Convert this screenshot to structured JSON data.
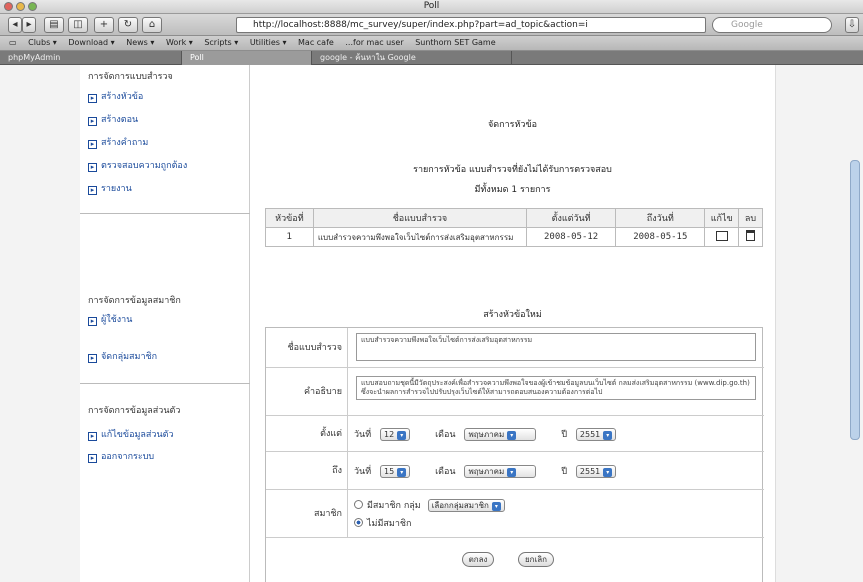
{
  "window": {
    "title": "Poll"
  },
  "toolbar": {
    "url": "http://localhost:8888/mc_survey/super/index.php?part=ad_topic&action=i",
    "search_placeholder": "Google"
  },
  "bookmarks": [
    "Clubs ▾",
    "Download ▾",
    "News ▾",
    "Work ▾",
    "Scripts ▾",
    "Utilities ▾",
    "Mac cafe",
    "...for mac user",
    "Sunthorn SET Game"
  ],
  "tabs": [
    "phpMyAdmin",
    "Poll",
    "google - ค้นหาใน Google"
  ],
  "sidebar": {
    "section1": {
      "title": "การจัดการแบบสำรวจ",
      "items": [
        "สร้างหัวข้อ",
        "สร้างตอน",
        "สร้างคำถาม",
        "ตรวจสอบความถูกต้อง",
        "รายงาน"
      ]
    },
    "section2": {
      "title": "การจัดการข้อมูลสมาชิก",
      "items": [
        "ผู้ใช้งาน",
        "จัดกลุ่มสมาชิก"
      ]
    },
    "section3": {
      "title": "การจัดการข้อมูลส่วนตัว",
      "items": [
        "แก้ไขข้อมูลส่วนตัว",
        "ออกจากระบบ"
      ]
    }
  },
  "main": {
    "page_title": "จัดการหัวข้อ",
    "list_title": "รายการหัวข้อ แบบสำรวจที่ยังไม่ได้รับการตรวจสอบ",
    "count_text": "มีทั้งหมด 1 รายการ",
    "table": {
      "headers": [
        "หัวข้อที่",
        "ชื่อแบบสำรวจ",
        "ตั้งแต่วันที่",
        "ถึงวันที่",
        "แก้ไข",
        "ลบ"
      ],
      "rows": [
        [
          "1",
          "แบบสำรวจความพึงพอใจเว็บไซต์การส่งเสริมอุตสาหกรรม",
          "2008-05-12",
          "2008-05-15"
        ]
      ]
    },
    "form": {
      "title": "สร้างหัวข้อใหม่",
      "name_label": "ชื่อแบบสำรวจ",
      "name_value": "แบบสำรวจความพึงพอใจเว็บไซต์การส่งเสริมอุตสาหกรรม",
      "desc_label": "คำอธิบาย",
      "desc_value": "แบบสอบถามชุดนี้มีวัตถุประสงค์เพื่อสำรวจความพึงพอใจของผู้เข้าชมข้อมูลบนเว็บไซต์ กลมส่งเสริมอุตสาหกรรม (www.dip.go.th) ซึ่งจะนำผลการสำรวจไปปรับปรุงเว็บไซต์ให้สามารถตอบสนองความต้องการต่อไป",
      "start_label": "ตั้งแต่",
      "end_label": "ถึง",
      "day_label": "วันที่",
      "month_label": "เดือน",
      "year_label": "ปี",
      "start": {
        "day": "12",
        "month": "พฤษภาคม",
        "year": "2551"
      },
      "end": {
        "day": "15",
        "month": "พฤษภาคม",
        "year": "2551"
      },
      "member_label": "สมาชิก",
      "member_opt1": "มีสมาชิก กลุ่ม",
      "member_group": "เลือกกลุ่มสมาชิก",
      "member_opt2": "ไม่มีสมาชิก",
      "submit_label": "ตกลง",
      "cancel_label": "ยกเลิก"
    }
  }
}
